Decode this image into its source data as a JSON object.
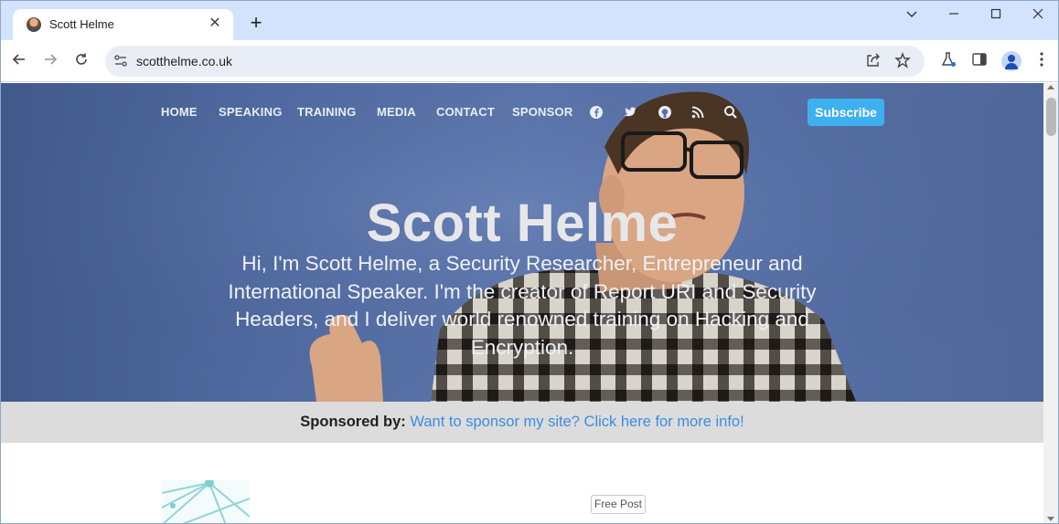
{
  "browser": {
    "tab_title": "Scott Helme",
    "new_tab_label": "+",
    "url": "scotthelme.co.uk",
    "window_controls": [
      "chevron-down-icon",
      "minimize-icon",
      "maximize-icon",
      "close-icon"
    ],
    "toolbar_icons": [
      "share-icon",
      "star-icon",
      "labs-icon",
      "side-panel-icon",
      "profile-icon",
      "more-icon"
    ]
  },
  "site": {
    "nav": [
      "HOME",
      "SPEAKING",
      "TRAINING",
      "MEDIA",
      "CONTACT",
      "SPONSOR"
    ],
    "social_icons": [
      "facebook-icon",
      "twitter-icon",
      "github-icon",
      "rss-icon",
      "search-icon"
    ],
    "subscribe_label": "Subscribe",
    "hero_title": "Scott Helme",
    "hero_description": "Hi, I'm Scott Helme, a Security Researcher, Entrepreneur and International Speaker. I'm the creator of Report URI and Security Headers, and I deliver world renowned training on Hacking and Encryption.",
    "sponsor_label": "Sponsored by:",
    "sponsor_link": "Want to sponsor my site? Click here for more info!",
    "free_post_badge": "Free Post"
  },
  "colors": {
    "accent": "#3eb0ef",
    "link": "#3c8de0",
    "tabstrip": "#d3e3fd"
  }
}
